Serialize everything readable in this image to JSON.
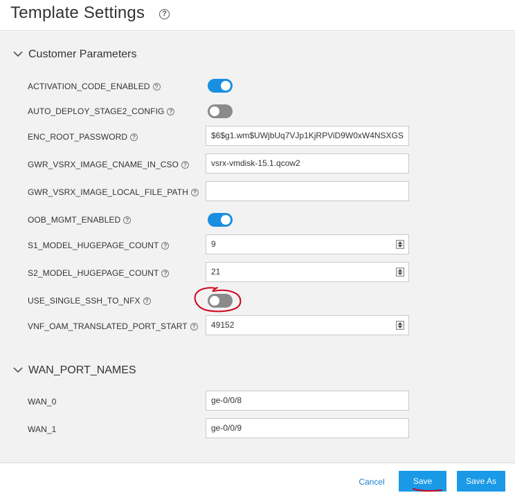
{
  "header": {
    "title": "Template Settings",
    "help_icon": "question-circle-icon"
  },
  "sections": {
    "customer": {
      "title": "Customer Parameters",
      "rows": [
        {
          "label": "ACTIVATION_CODE_ENABLED",
          "type": "toggle",
          "state": "on"
        },
        {
          "label": "AUTO_DEPLOY_STAGE2_CONFIG",
          "type": "toggle",
          "state": "off"
        },
        {
          "label": "ENC_ROOT_PASSWORD",
          "type": "text",
          "value": "$6$g1.wm$UWjbUq7VJp1KjRPViD9W0xW4NSXGS"
        },
        {
          "label": "GWR_VSRX_IMAGE_CNAME_IN_CSO",
          "type": "text",
          "value": "vsrx-vmdisk-15.1.qcow2"
        },
        {
          "label": "GWR_VSRX_IMAGE_LOCAL_FILE_PATH",
          "type": "text",
          "value": ""
        },
        {
          "label": "OOB_MGMT_ENABLED",
          "type": "toggle",
          "state": "on"
        },
        {
          "label": "S1_MODEL_HUGEPAGE_COUNT",
          "type": "number",
          "value": "9"
        },
        {
          "label": "S2_MODEL_HUGEPAGE_COUNT",
          "type": "number",
          "value": "21"
        },
        {
          "label": "USE_SINGLE_SSH_TO_NFX",
          "type": "toggle",
          "state": "off"
        },
        {
          "label": "VNF_OAM_TRANSLATED_PORT_START",
          "type": "number",
          "value": "49152"
        }
      ]
    },
    "wan": {
      "title": "WAN_PORT_NAMES",
      "rows": [
        {
          "label": "WAN_0",
          "type": "text",
          "value": "ge-0/0/8"
        },
        {
          "label": "WAN_1",
          "type": "text",
          "value": "ge-0/0/9"
        }
      ]
    }
  },
  "footer": {
    "cancel_label": "Cancel",
    "save_label": "Save",
    "save_as_label": "Save As"
  },
  "colors": {
    "accent": "#1a9ae6",
    "toggle_on": "#1a8fe0",
    "toggle_off": "#8a8a8a",
    "annotation": "#d0021b"
  }
}
